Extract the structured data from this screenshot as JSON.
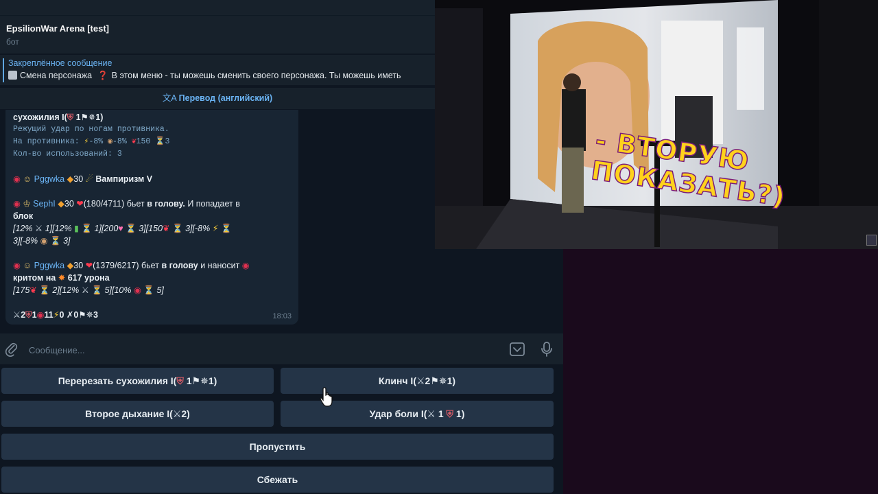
{
  "header": {
    "title": "EpsilionWar Arena [test]",
    "subtitle": "бот"
  },
  "pinned": {
    "title": "Закреплённое сообщение",
    "text": "Смена персонажа",
    "text2": "В этом меню - ты можешь сменить своего персонажа. Ты можешь иметь"
  },
  "translate": {
    "label": "Перевод (английский)"
  },
  "message": {
    "line1": "сухожилия I(",
    "line1_n1": "1",
    "line1_n2": "1)",
    "desc": "Режущий удар по ногам противника.",
    "effect_prefix": "На противника:",
    "effect_v1": "-8%",
    "effect_v2": "-8%",
    "effect_v3": "150",
    "effect_v4": "3",
    "uses": "Кол-во использований: 3",
    "e1_nick": "Pggwka",
    "e1_level": "30",
    "e1_skill": "Вампиризм V",
    "e2_nick": "SephI",
    "e2_level": "30",
    "e2_hp": "(180/4711) бьет",
    "e2_target": "в голову.",
    "e2_rest": "И попадает в",
    "e2_block": "блок",
    "e2_stats1a": "[12%",
    "e2_stats1b": "1][12%",
    "e2_stats1c": "1][200",
    "e2_stats1d": "3][150",
    "e2_stats1e": "3][-8%",
    "e2_stats2a": "3][-8%",
    "e2_stats2b": "3]",
    "e3_nick": "Pggwka",
    "e3_level": "30",
    "e3_hp": "(1379/6217) бьет",
    "e3_target": "в голову",
    "e3_rest": "и наносит",
    "e3_crit": "критом на",
    "e3_dmg": "617",
    "e3_dmg_unit": "урона",
    "e3_stats_a": "[175",
    "e3_stats_b": "2][12%",
    "e3_stats_c": "5][10%",
    "e3_stats_d": "5]",
    "res_a": "2",
    "res_b": "1",
    "res_c": "11",
    "res_d": "0",
    "res_e": "0",
    "res_f": "3",
    "time": "18:03"
  },
  "input": {
    "placeholder": "Сообщение..."
  },
  "keyboard": {
    "btn_cut": "Перерезать сухожилия I(",
    "btn_cut_n1": "1",
    "btn_cut_n2": "1)",
    "btn_clinch": "Клинч I(",
    "btn_clinch_n1": "2",
    "btn_clinch_n2": "1)",
    "btn_breath": "Второе дыхание I(",
    "btn_breath_n1": "2)",
    "btn_pain": "Удар боли I(",
    "btn_pain_n1": "1",
    "btn_pain_n2": "1)",
    "btn_skip": "Пропустить",
    "btn_flee": "Сбежать"
  },
  "video": {
    "caption": "- ВТОРУЮ ПОКАЗАТЬ?)"
  },
  "colors": {
    "chat_bg": "#0e1621",
    "panel_bg": "#17212b",
    "bubble_bg": "#182533",
    "button_bg": "#243447",
    "accent": "#6ab3f3",
    "right_bg": "#1a0a1c"
  }
}
